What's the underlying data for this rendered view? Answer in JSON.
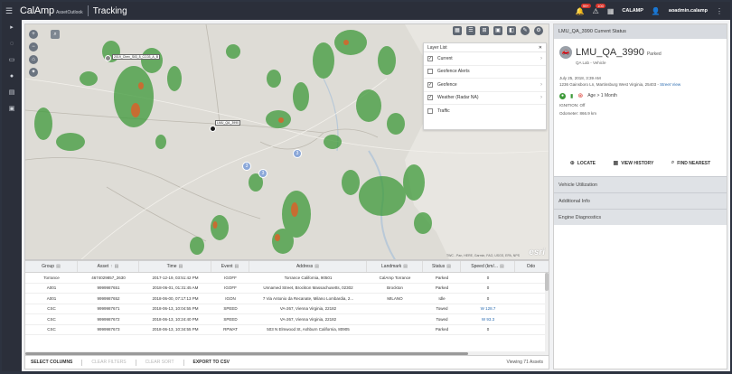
{
  "header": {
    "brand": "CalAmp",
    "brand_sub": "AssetOutlook",
    "app_title": "Tracking",
    "notif_badge": "99+",
    "alert_badge": "100",
    "org": "CALAMP",
    "user": "aoadmin.calamp"
  },
  "map": {
    "attribution": "TWC - Pan, HERE, Garmin, FAO, USGS, EPA, NPS",
    "esri": "esri",
    "vehicle_labels": [
      "2019_Chev_Sil3_8_CC03_A_B",
      "LMU_QA_3990"
    ],
    "clusters": [
      "3",
      "3",
      "3"
    ]
  },
  "layer_list": {
    "title": "Layer List",
    "items": [
      {
        "label": "Current",
        "checked": true
      },
      {
        "label": "Geofence Alerts",
        "checked": false
      },
      {
        "label": "Geofence",
        "checked": true
      },
      {
        "label": "Weather (Radar NA)",
        "checked": true
      },
      {
        "label": "Traffic",
        "checked": false
      }
    ]
  },
  "status_panel": {
    "title": "LMU_QA_3990 Current Status",
    "asset_name": "LMU_QA_3990",
    "state": "Parked",
    "subtitle": "QA Lab - Vehicle",
    "date": "July 25, 2018, 3:39 AM",
    "address": "1236 Gainsboro Ln, Martinsburg West Virginia, 25403 - ",
    "street_view": "Street View",
    "age": "Age > 1 Month",
    "ignition": "IGNITION: Off",
    "odometer": "Odometer: 866.9 km",
    "actions": [
      "LOCATE",
      "VIEW HISTORY",
      "FIND NEAREST"
    ],
    "sections": [
      "Vehicle Utilization",
      "Additional Info",
      "Engine Diagnostics"
    ]
  },
  "table": {
    "columns": [
      "Group",
      "Asset",
      "Time",
      "Event",
      "Address",
      "Landmark",
      "Status",
      "Speed (km/...",
      "Odo"
    ],
    "rows": [
      [
        "Torrance",
        "4674029857_2630",
        "2017-12-19, 03:51:42 PM",
        "IGOFF",
        "Torrance California, 90501",
        "CalAmp Torrance",
        "Parked",
        "0"
      ],
      [
        "A001",
        "9999987651",
        "2018-06-01, 01:31:45 AM",
        "IGOFF",
        "Unnamed Street, Brockton Massachusetts, 02302",
        "Brockton",
        "Parked",
        "0"
      ],
      [
        "A001",
        "9999987652",
        "2018-06-00, 07:17:13 PM",
        "IGON",
        "7 Via Antonio da Recanate, Milano Lombardia, 2...",
        "MILANO",
        "Idle",
        "0"
      ],
      [
        "CSC",
        "9999987671",
        "2018-06-13, 10:04:55 PM",
        "SPEED",
        "VA-267, Vienna Virginia, 22182",
        "",
        "Towed",
        "W 128.7"
      ],
      [
        "CSC",
        "9999987672",
        "2018-06-13, 10:24:40 PM",
        "SPEED",
        "VA-267, Vienna Virginia, 22182",
        "",
        "Towed",
        "W 93.3"
      ],
      [
        "CSC",
        "9999987673",
        "2018-06-13, 10:34:55 PM",
        "RPWAT",
        "503 N Elmwood St, Ashburn California, 80905",
        "",
        "Parked",
        "0"
      ]
    ]
  },
  "footer": {
    "select_columns": "SELECT COLUMNS",
    "clear_filters": "CLEAR FILTERS",
    "clear_sort": "CLEAR SORT",
    "export": "EXPORT TO CSV",
    "viewing": "Viewing 71 Assets"
  },
  "colors": {
    "header_bg": "#2b2f3a",
    "accent_link": "#2b6cb0",
    "alert_red": "#d9342b",
    "radar_green": "#3e9a3a",
    "radar_orange": "#d9632a"
  }
}
